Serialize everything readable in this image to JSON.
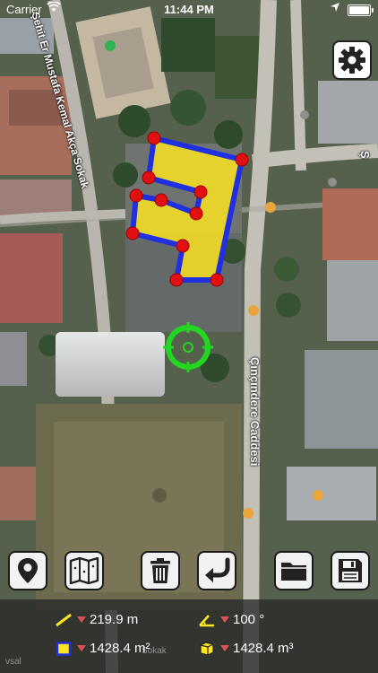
{
  "status_bar": {
    "carrier": "Carrier",
    "time": "11:44 PM",
    "battery_level": 1.0
  },
  "map": {
    "streets": [
      {
        "name": "Şehit Er Mustafa Kemal Akça Sokak",
        "label": "Şehit Er Mustafa Kemal Akça Sokak"
      },
      {
        "name": "Çınçındere Caddesi",
        "label": "Çınçındere Caddesi"
      },
      {
        "name": "partial-east",
        "label": "Ş"
      }
    ],
    "watermarks": [
      "Sokak",
      "vsal"
    ]
  },
  "toolbar": {
    "buttons": [
      {
        "name": "location-button",
        "icon": "map-pin-icon"
      },
      {
        "name": "map-type-button",
        "icon": "folded-map-icon"
      },
      {
        "name": "delete-button",
        "icon": "trash-icon"
      },
      {
        "name": "undo-button",
        "icon": "return-arrow-icon"
      },
      {
        "name": "open-button",
        "icon": "folder-icon"
      },
      {
        "name": "save-button",
        "icon": "floppy-disk-icon"
      }
    ],
    "settings_icon": "gear-icon"
  },
  "measurements": {
    "distance": "219.9 m",
    "angle": "100 °",
    "area": "1428.4 m²",
    "volume": "1428.4 m³"
  },
  "colors": {
    "polygon_stroke": "#2030e0",
    "polygon_fill": "#ffe61e",
    "vertex": "#e01010",
    "crosshair": "#22d622",
    "indicator_triangle": "#e05050"
  }
}
